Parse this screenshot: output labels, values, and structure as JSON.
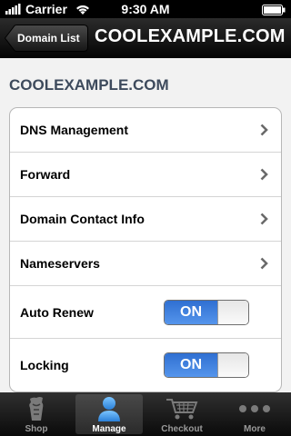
{
  "status_bar": {
    "carrier": "Carrier",
    "time": "9:30 AM"
  },
  "nav_bar": {
    "back_label": "Domain List",
    "title": "COOLEXAMPLE.COM"
  },
  "section": {
    "header": "COOLEXAMPLE.COM"
  },
  "menu_items": [
    {
      "label": "DNS Management"
    },
    {
      "label": "Forward"
    },
    {
      "label": "Domain Contact Info"
    },
    {
      "label": "Nameservers"
    }
  ],
  "toggles": [
    {
      "label": "Auto Renew",
      "state": "ON",
      "value": true
    },
    {
      "label": "Locking",
      "state": "ON",
      "value": true
    }
  ],
  "tab_bar": {
    "selected": "Manage",
    "tabs": [
      {
        "label": "Shop",
        "icon": "shop-icon"
      },
      {
        "label": "Manage",
        "icon": "manage-person-icon"
      },
      {
        "label": "Checkout",
        "icon": "cart-icon"
      },
      {
        "label": "More",
        "icon": "more-dots-icon"
      }
    ]
  },
  "colors": {
    "toggle_on": "#3a7ddc",
    "section_header": "#3d4a5c",
    "nav_bar": "#1a1a1a",
    "tab_selected_icon": "#4a9fe6"
  }
}
